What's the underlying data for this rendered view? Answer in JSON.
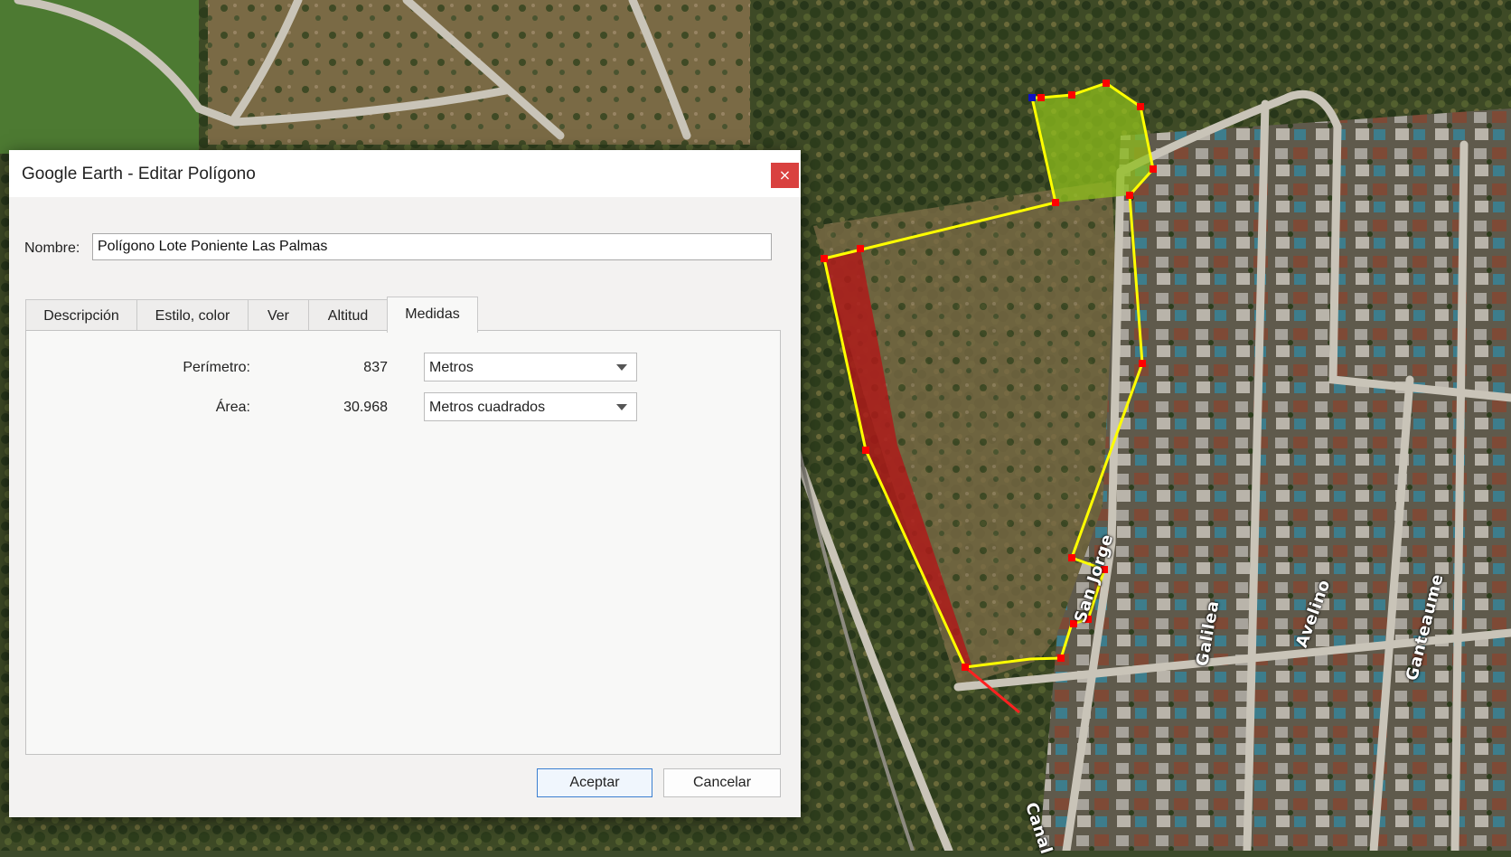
{
  "dialog": {
    "title": "Google Earth - Editar Polígono",
    "close_symbol": "×",
    "name_label": "Nombre:",
    "name_value": "Polígono Lote Poniente Las Palmas",
    "tabs": [
      {
        "label": "Descripción",
        "active": false
      },
      {
        "label": "Estilo, color",
        "active": false
      },
      {
        "label": "Ver",
        "active": false
      },
      {
        "label": "Altitud",
        "active": false
      },
      {
        "label": "Medidas",
        "active": true
      }
    ],
    "measures": {
      "perimeter_label": "Perímetro:",
      "perimeter_value": "837",
      "perimeter_unit": "Metros",
      "area_label": "Área:",
      "area_value": "30.968",
      "area_unit": "Metros cuadrados"
    },
    "ok_label": "Aceptar",
    "cancel_label": "Cancelar"
  },
  "map": {
    "street_labels": [
      "San Jorge",
      "Galilea",
      "Avelino",
      "Ganteaume",
      "Canal"
    ],
    "colors": {
      "polygon_outline": "#ffff00",
      "red_polygon_fill": "#b01818",
      "green_polygon_fill": "#8fbf1c",
      "vertex": "#ff0000",
      "selected_vertex": "#1010c0"
    }
  }
}
